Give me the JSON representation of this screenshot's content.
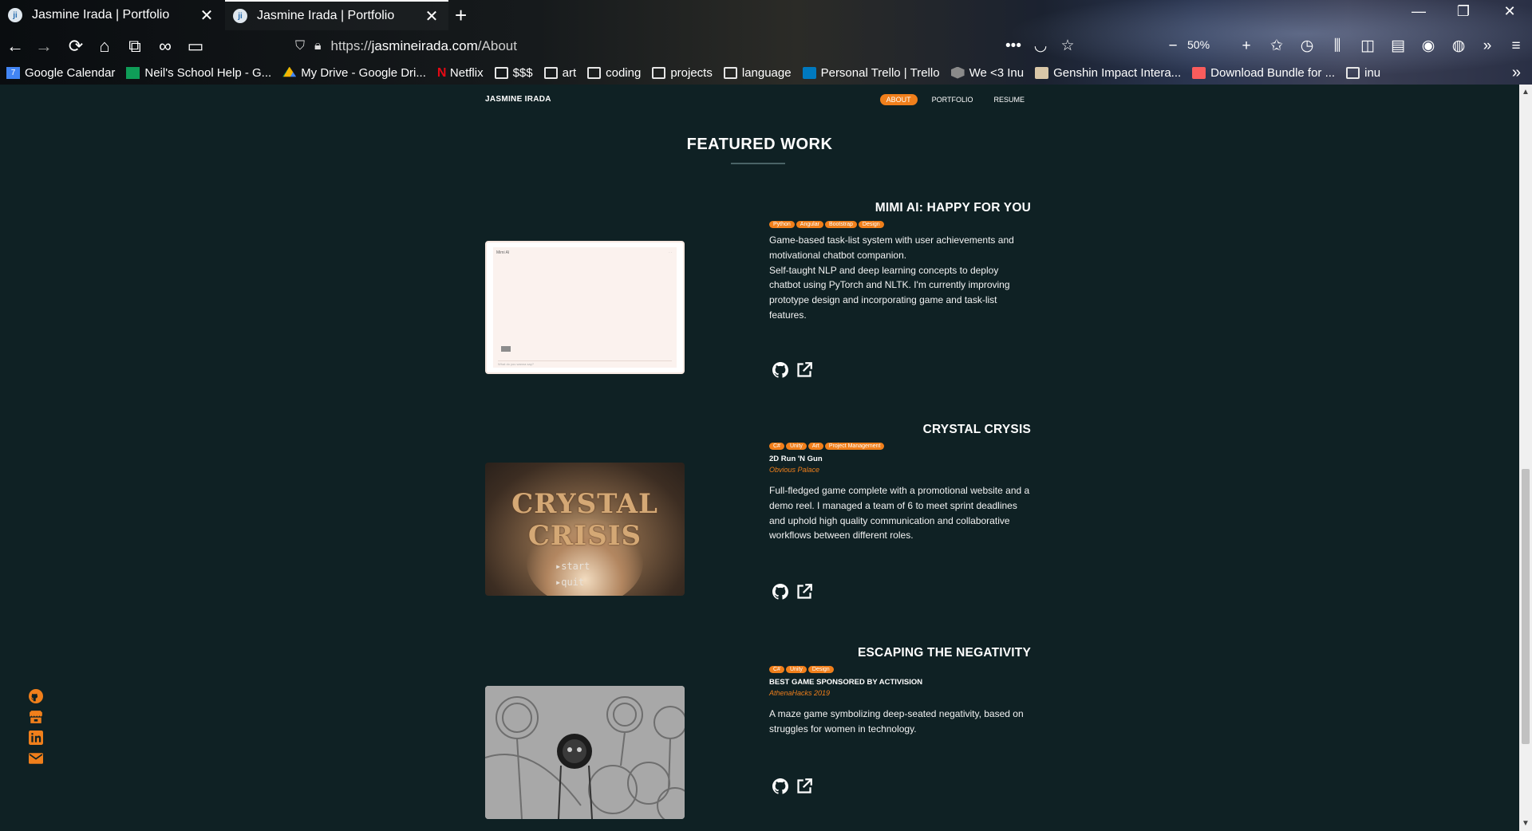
{
  "browser": {
    "tabs": [
      {
        "title": "Jasmine Irada | Portfolio",
        "active": false
      },
      {
        "title": "Jasmine Irada | Portfolio",
        "active": true
      }
    ],
    "url_prefix": "https://",
    "url_host": "jasmineirada.com",
    "url_path": "/About",
    "zoom": "50%",
    "bookmarks": [
      {
        "label": "Google Calendar",
        "icon": "calendar-icon"
      },
      {
        "label": "Neil's School Help - G...",
        "icon": "sheets-icon"
      },
      {
        "label": "My Drive - Google Dri...",
        "icon": "drive-icon"
      },
      {
        "label": "Netflix",
        "icon": "netflix-icon"
      },
      {
        "label": "$$$",
        "icon": "folder-icon"
      },
      {
        "label": "art",
        "icon": "folder-icon"
      },
      {
        "label": "coding",
        "icon": "folder-icon"
      },
      {
        "label": "projects",
        "icon": "folder-icon"
      },
      {
        "label": "language",
        "icon": "folder-icon"
      },
      {
        "label": "Personal Trello | Trello",
        "icon": "trello-icon"
      },
      {
        "label": "We <3 Inu",
        "icon": "cube-icon"
      },
      {
        "label": "Genshin Impact Intera...",
        "icon": "genshin-icon"
      },
      {
        "label": "Download Bundle for ...",
        "icon": "itch-icon"
      },
      {
        "label": "inu",
        "icon": "folder-icon"
      }
    ]
  },
  "site": {
    "brand": "JASMINE IRADA",
    "nav": [
      "ABOUT",
      "PORTFOLIO",
      "RESUME"
    ],
    "nav_active": "ABOUT",
    "section_title": "FEATURED WORK",
    "accent_color": "#f07f1b",
    "background_color": "#0f2124"
  },
  "projects": [
    {
      "title": "MIMI AI: HAPPY FOR YOU",
      "tags": [
        "Python",
        "Angular",
        "Bootstrap",
        "Design"
      ],
      "description": "Game-based task-list system with user achievements and motivational chatbot companion.\nSelf-taught NLP and deep learning concepts to deploy chatbot using PyTorch and NLTK. I'm currently improving prototype design and incorporating game and task-list features.",
      "thumb": {
        "header": "Mimi AI",
        "chip": "",
        "input": "What do you wanna say?"
      }
    },
    {
      "title": "CRYSTAL CRYSIS",
      "tags": [
        "C#",
        "Unity",
        "Art",
        "Project Management"
      ],
      "subtitle": "2D Run 'N Gun",
      "event": "Obvious Palace",
      "description": "Full-fledged game complete with a promotional website and a demo reel. I managed a team of 6 to meet sprint deadlines and uphold high quality communication and collaborative workflows between different roles.",
      "thumb": {
        "title": "CRYSTAL CRISIS",
        "menu1": "▸start",
        "menu2": "▸quit"
      }
    },
    {
      "title": "ESCAPING THE NEGATIVITY",
      "tags": [
        "C#",
        "Unity",
        "Design"
      ],
      "subtitle": "BEST GAME SPONSORED BY ACTIVISION",
      "event": "AthenaHacks 2019",
      "description": "A maze game symbolizing deep-seated negativity, based on struggles for women in technology."
    }
  ],
  "social": [
    "github-icon",
    "itch-icon",
    "linkedin-icon",
    "email-icon"
  ]
}
